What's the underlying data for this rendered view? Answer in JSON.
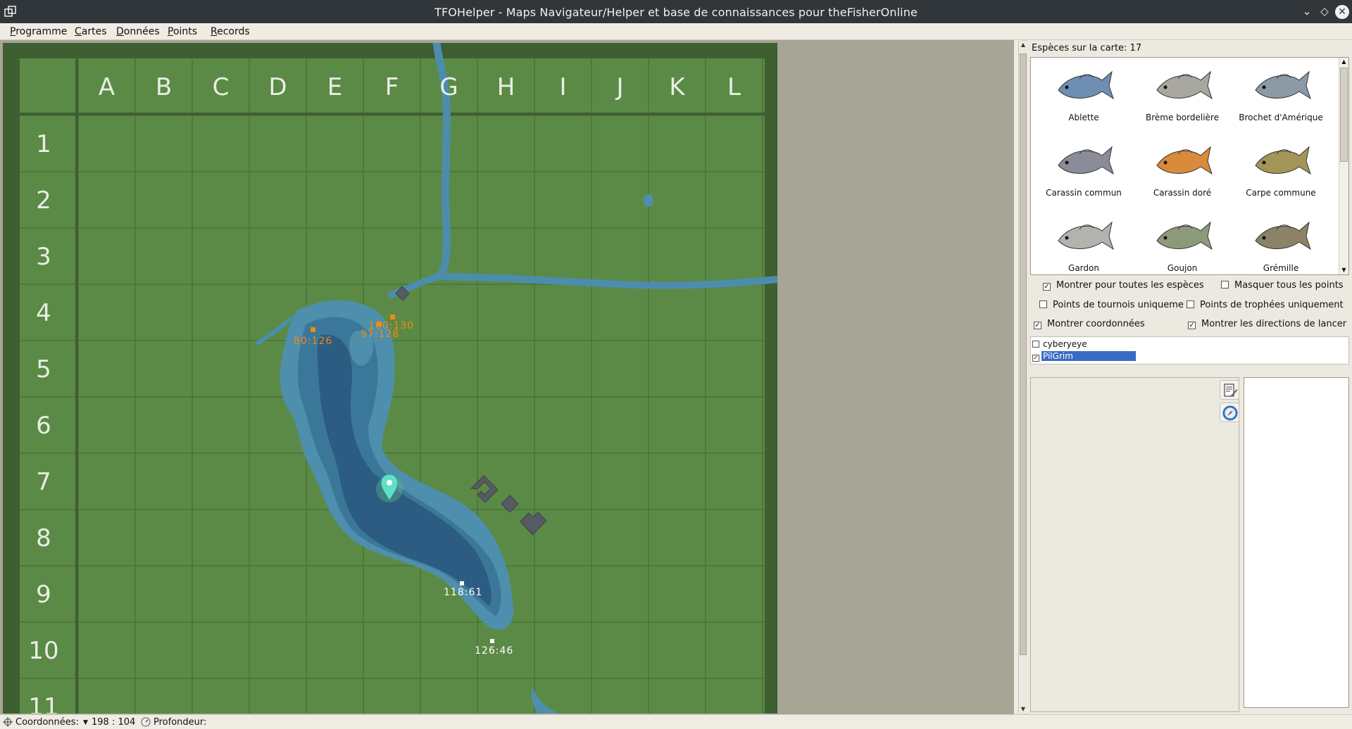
{
  "window": {
    "title": "TFOHelper - Maps Navigateur/Helper et base de connaissances pour theFisherOnline",
    "icons": {
      "app": "app-icon",
      "minimize": "chevron-down-icon",
      "maximize": "diamond-icon",
      "close": "close-icon"
    }
  },
  "menu": [
    "Programme",
    "Cartes",
    "Données",
    "Points",
    "Records"
  ],
  "map": {
    "columns": [
      "A",
      "B",
      "C",
      "D",
      "E",
      "F",
      "G",
      "H",
      "I",
      "J",
      "K",
      "L"
    ],
    "rows": [
      "1",
      "2",
      "3",
      "4",
      "5",
      "6",
      "7",
      "8",
      "9",
      "10",
      "11"
    ],
    "points": [
      {
        "label": "80:126",
        "color": "#f28a10"
      },
      {
        "label": "97:128",
        "color": "#f28a10"
      },
      {
        "label": "100:130",
        "color": "#f28a10"
      },
      {
        "label": "118:61",
        "color": "#ffffff"
      },
      {
        "label": "126:46",
        "color": "#ffffff"
      }
    ],
    "colors": {
      "grass": "#5b8a46",
      "grid_line": "#4b7338",
      "frame": "#3e5f31",
      "water_shallow": "#4d8fac",
      "water_mid": "#3b7799",
      "water_deep": "#2c5c82",
      "river": "#4c8dae",
      "marker": "#5ee0c8"
    },
    "marker_icon": "location-pin-icon"
  },
  "sidebar": {
    "species_count_label": "Espèces sur la carte: 17",
    "species": [
      {
        "name": "Ablette",
        "icon": "fish-icon"
      },
      {
        "name": "Brème bordelière",
        "icon": "fish-icon"
      },
      {
        "name": "Brochet d'Amérique",
        "icon": "fish-icon"
      },
      {
        "name": "Carassin commun",
        "icon": "fish-icon"
      },
      {
        "name": "Carassin doré",
        "icon": "fish-icon"
      },
      {
        "name": "Carpe commune",
        "icon": "fish-icon"
      },
      {
        "name": "Gardon",
        "icon": "fish-icon"
      },
      {
        "name": "Goujon",
        "icon": "fish-icon"
      },
      {
        "name": "Grémille",
        "icon": "fish-icon"
      }
    ],
    "options": {
      "show_all_species": {
        "label": "Montrer pour toutes les espèces",
        "checked": true
      },
      "hide_all_points": {
        "label": "Masquer tous les points",
        "checked": false
      },
      "tournament_points": {
        "label": "Points de tournois uniqueme",
        "checked": false
      },
      "trophy_points": {
        "label": "Points de trophées uniquement",
        "checked": false
      },
      "show_coords": {
        "label": "Montrer coordonnées",
        "checked": true
      },
      "show_cast_dirs": {
        "label": "Montrer les directions de lancer",
        "checked": true
      }
    },
    "users": [
      {
        "name": "cyberyeye",
        "checked": false,
        "selected": false
      },
      {
        "name": "PilGrim",
        "checked": true,
        "selected": true
      }
    ],
    "tool_icons": [
      "edit-note-icon",
      "compass-icon"
    ]
  },
  "status": {
    "coords_label": "Coordonnées:",
    "coords_value": "198 : 104",
    "depth_label": "Profondeur:",
    "icons": [
      "crosshair-icon",
      "dropdown-arrow-icon",
      "depth-gauge-icon"
    ]
  }
}
